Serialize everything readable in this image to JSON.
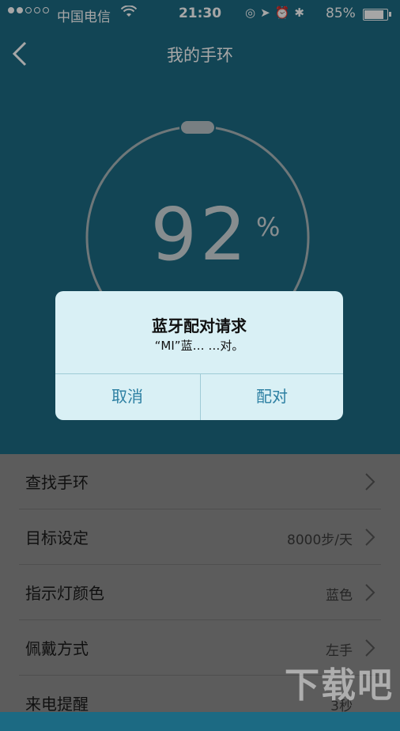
{
  "status": {
    "carrier": "中国电信",
    "time": "21:30",
    "battery": "85%"
  },
  "nav": {
    "title": "我的手环"
  },
  "band": {
    "percent": "92",
    "percent_sign": "%"
  },
  "dialog": {
    "title": "蓝牙配对请求",
    "message": "“MI”蓝… …对。",
    "cancel": "取消",
    "confirm": "配对"
  },
  "settings": [
    {
      "label": "查找手环",
      "value": ""
    },
    {
      "label": "目标设定",
      "value": "8000步/天"
    },
    {
      "label": "指示灯颜色",
      "value": "蓝色"
    },
    {
      "label": "佩戴方式",
      "value": "左手"
    },
    {
      "label": "来电提醒",
      "value": "3秒"
    }
  ],
  "watermark": "下载吧",
  "colors": {
    "header_bg": "#1c6a83",
    "dialog_bg": "#d9f0f5",
    "dialog_button": "#2c7fa2"
  }
}
